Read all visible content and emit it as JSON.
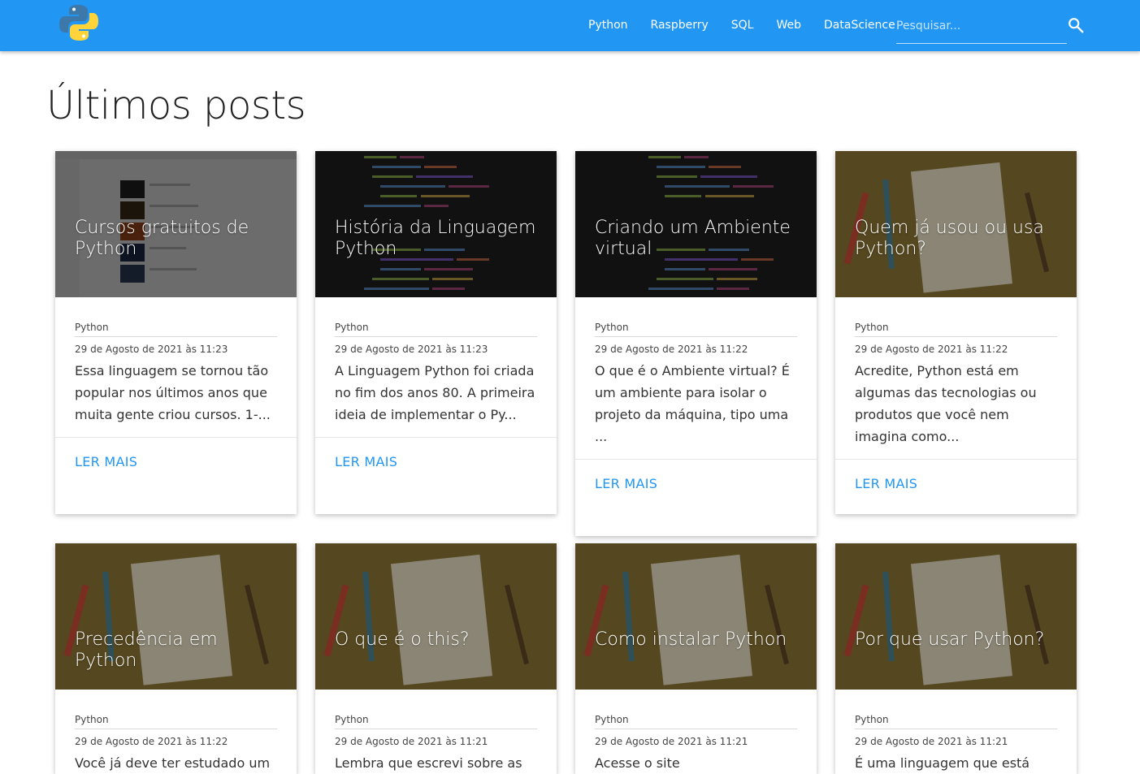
{
  "nav": {
    "links": [
      "Python",
      "Raspberry",
      "SQL",
      "Web",
      "DataScience"
    ],
    "search_placeholder": "Pesquisar..."
  },
  "page_title": "Últimos posts",
  "read_more_label": "LER MAIS",
  "colors": {
    "navbar": "#2196f3",
    "link": "#2196f3",
    "artigo_bg": "#55471f",
    "code_bg": "#1a1a1a"
  },
  "cards": [
    {
      "title": "Cursos gratuitos de Python",
      "category": "Python",
      "date": "29 de Agosto de 2021 às 11:23",
      "excerpt": "Essa linguagem se tornou tão popular nos últimos anos que muita gente criou cursos. 1-...",
      "image": "youtube-screenshot"
    },
    {
      "title": "História da Linguagem Python",
      "category": "Python",
      "date": "29 de Agosto de 2021 às 11:23",
      "excerpt": "A Linguagem Python foi criada no fim dos anos 80. A primeira ideia de implementar o Py...",
      "image": "code"
    },
    {
      "title": "Criando um Ambiente virtual",
      "category": "Python",
      "date": "29 de Agosto de 2021 às 11:22",
      "excerpt": "O que é o Ambiente virtual? É um ambiente para isolar o projeto da máquina, tipo uma ...",
      "image": "code"
    },
    {
      "title": "Quem já usou ou usa Python?",
      "category": "Python",
      "date": "29 de Agosto de 2021 às 11:22",
      "excerpt": "Acredite, Python está em algumas das tecnologias ou produtos que você nem imagina como...",
      "image": "artigo"
    },
    {
      "title": "Precedência em Python",
      "category": "Python",
      "date": "29 de Agosto de 2021 às 11:22",
      "excerpt": "Você já deve ter estudado um",
      "image": "artigo"
    },
    {
      "title": "O que é o this?",
      "category": "Python",
      "date": "29 de Agosto de 2021 às 11:21",
      "excerpt": "Lembra que escrevi sobre as",
      "image": "artigo"
    },
    {
      "title": "Como instalar Python",
      "category": "Python",
      "date": "29 de Agosto de 2021 às 11:21",
      "excerpt": "Acesse o site",
      "image": "artigo"
    },
    {
      "title": "Por que usar Python?",
      "category": "Python",
      "date": "29 de Agosto de 2021 às 11:21",
      "excerpt": "É uma linguagem que está",
      "image": "artigo"
    }
  ]
}
